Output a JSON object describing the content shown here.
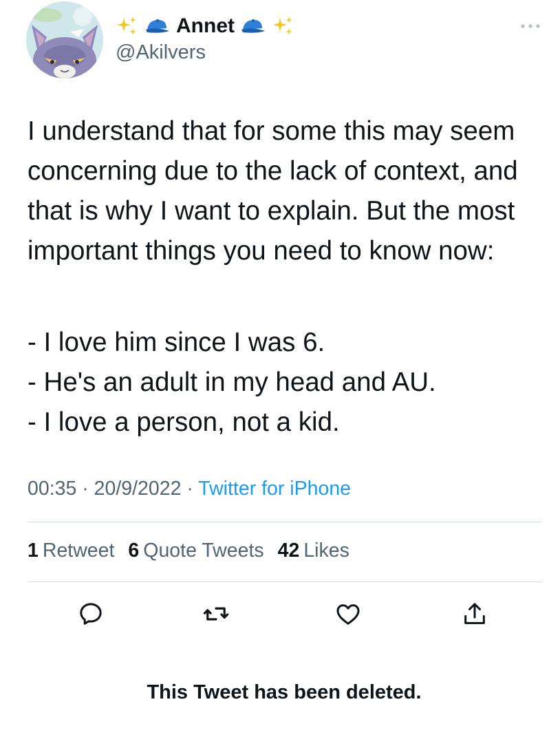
{
  "user": {
    "display_name": "Annet",
    "handle": "@Akilvers",
    "name_emojis": [
      "sparkles-icon",
      "blue-cap-icon"
    ]
  },
  "tweet": {
    "text": "I understand that for some this may seem concerning due to the lack of context, and that is why I want to explain. But the most important things you need to know now:",
    "list": [
      "- I love him since I was 6.",
      "- He's an adult in my head and AU.",
      "- I love a person, not a kid."
    ]
  },
  "meta": {
    "time": "00:35",
    "sep1": " · ",
    "date": "20/9/2022",
    "sep2": " · ",
    "source": "Twitter for iPhone"
  },
  "stats": {
    "retweets_count": "1",
    "retweets_label": "Retweet",
    "quotes_count": "6",
    "quotes_label": "Quote Tweets",
    "likes_count": "42",
    "likes_label": "Likes"
  },
  "actions": [
    "reply-icon",
    "retweet-icon",
    "like-icon",
    "share-icon"
  ],
  "notice": "This Tweet has been deleted.",
  "colors": {
    "text": "#0f1419",
    "secondary": "#536471",
    "link": "#1d9bf0",
    "divider": "#cfd9de"
  }
}
